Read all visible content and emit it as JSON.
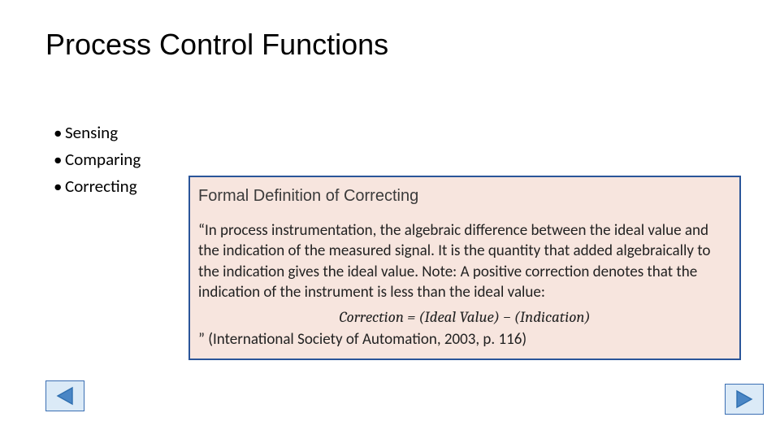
{
  "title": "Process Control Functions",
  "bullets": {
    "items": [
      {
        "label": "Sensing"
      },
      {
        "label": "Comparing"
      },
      {
        "label": "Correcting"
      }
    ]
  },
  "definition": {
    "heading": "Formal Definition of Correcting",
    "body_open_quote": "“",
    "body_text": "In process instrumentation, the algebraic difference between the ideal value and the indication of the measured signal. It is the quantity that added algebraically to the indication gives the ideal value. Note: A positive correction denotes that the indication of the instrument is less than the ideal value:",
    "formula": "Correction = (Ideal Value) − (Indication)",
    "citation": "” (International Society of Automation, 2003, p. 116)"
  },
  "nav": {
    "prev_icon": "triangle-left",
    "next_icon": "triangle-right"
  },
  "colors": {
    "box_border": "#2a5599",
    "box_fill": "#f7e5de",
    "nav_fill": "#dbeaf7",
    "nav_border": "#3b6fb3",
    "nav_arrow": "#2f6fb0"
  }
}
